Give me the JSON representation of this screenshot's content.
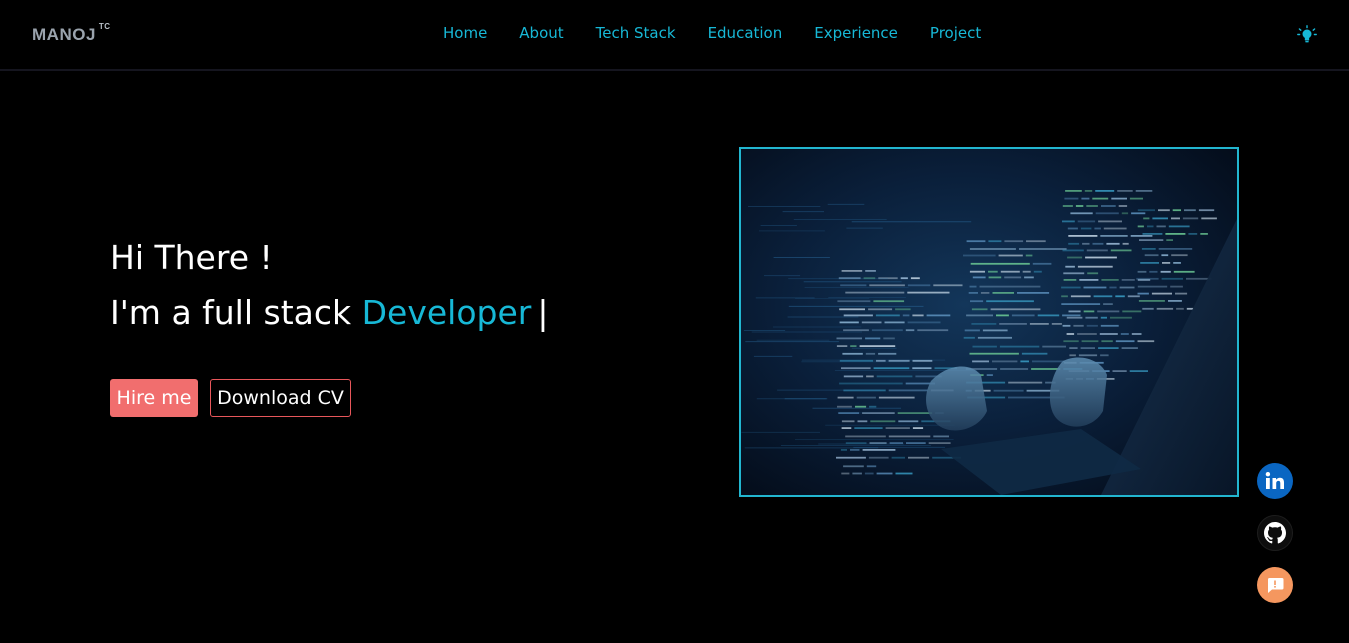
{
  "brand": {
    "name": "MANOJ",
    "mark": "TC"
  },
  "nav": {
    "links": [
      {
        "label": "Home"
      },
      {
        "label": "About"
      },
      {
        "label": "Tech Stack"
      },
      {
        "label": "Education"
      },
      {
        "label": "Experience"
      },
      {
        "label": "Project"
      }
    ],
    "theme_icon": "lightbulb-icon"
  },
  "hero": {
    "greeting": "Hi There !",
    "intro_prefix": "I'm a full stack ",
    "intro_highlight": "Developer",
    "cursor": "|",
    "hire_label": "Hire me",
    "cv_label": "Download CV",
    "image_icon": "developer-laptop-code-image"
  },
  "social": [
    {
      "icon": "linkedin-icon",
      "label": "in"
    },
    {
      "icon": "github-icon"
    },
    {
      "icon": "chat-icon"
    }
  ],
  "colors": {
    "background": "#000000",
    "accent": "#17b8d6",
    "hire_button": "#f16e6e",
    "cv_border": "#e8575b",
    "image_border": "#22b6d0",
    "linkedin": "#0a66c2",
    "chat": "#f5975f",
    "brand_text": "#9aa3ad"
  }
}
